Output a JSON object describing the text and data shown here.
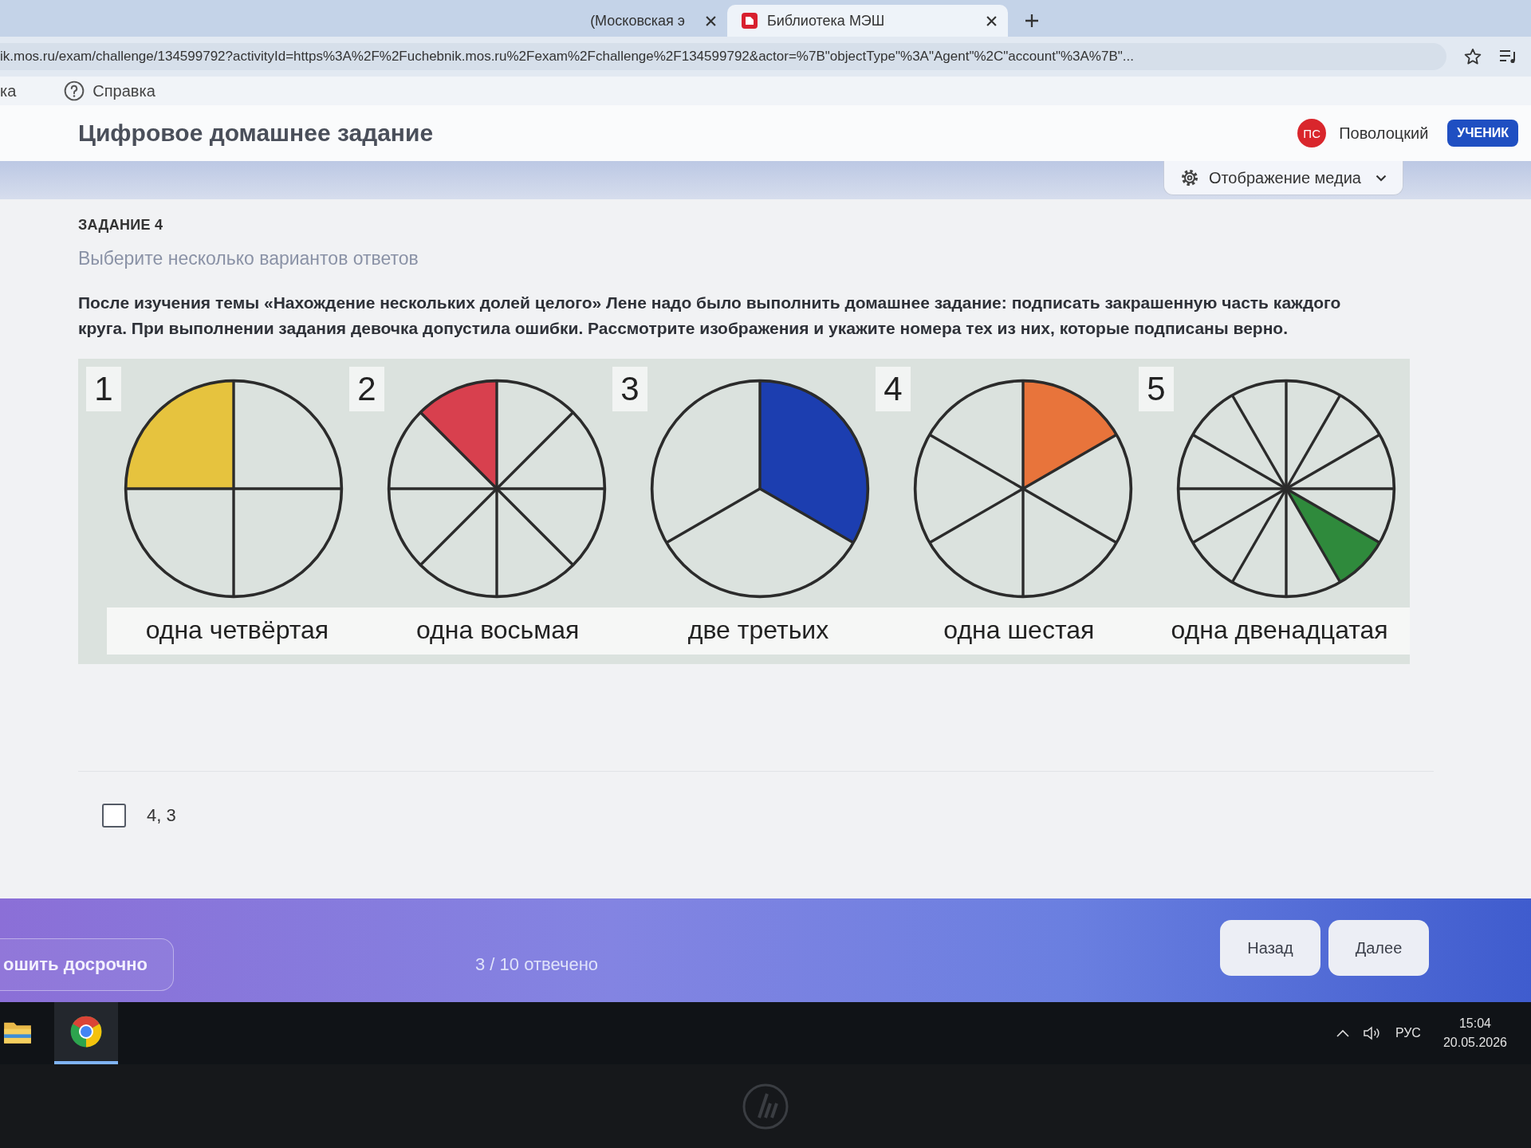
{
  "browser": {
    "tabs": [
      {
        "title": "(Московская э",
        "favicon": false,
        "selected": false
      },
      {
        "title": "Библиотека МЭШ",
        "favicon": true,
        "selected": true
      }
    ],
    "address": "ik.mos.ru/exam/challenge/134599792?activityId=https%3A%2F%2Fuchebnik.mos.ru%2Fexam%2Fchallenge%2F134599792&actor=%7B\"objectType\"%3A\"Agent\"%2C\"account\"%3A%7B\"...",
    "bookmarks": [
      {
        "label": "ка",
        "kind": "plain"
      },
      {
        "label": "Справка",
        "kind": "help"
      }
    ]
  },
  "header": {
    "title": "Цифровое домашнее задание",
    "user": {
      "initials": "ПС",
      "name": "Поволоцкий",
      "role": "УЧЕНИК"
    },
    "media_menu": "Отображение медиа"
  },
  "task": {
    "number": "ЗАДАНИЕ 4",
    "instruction": "Выберите несколько вариантов ответов",
    "text": "После изучения темы «Нахождение нескольких долей целого» Лене надо было выполнить домашнее задание: подписать закрашенную часть каждого круга. При выполнении задания девочка допустила ошибки. Рассмотрите изображения и укажите номера тех из них, которые подписаны верно.",
    "figure": {
      "items": [
        {
          "number": "1",
          "caption": "одна четвёртая",
          "kind": "quarters",
          "color": "#e6c33e"
        },
        {
          "number": "2",
          "caption": "одна восьмая",
          "kind": "eighths",
          "color": "#d8404e"
        },
        {
          "number": "3",
          "caption": "две третьих",
          "kind": "thirds",
          "color": "#1c3eb0"
        },
        {
          "number": "4",
          "caption": "одна шестая",
          "kind": "sixths",
          "color": "#e8743b"
        },
        {
          "number": "5",
          "caption": "одна двенадцатая",
          "kind": "twelfths",
          "color": "#2f8a3c"
        }
      ]
    },
    "options": [
      {
        "label": "4, 3",
        "checked": false
      }
    ]
  },
  "footer": {
    "finish": "ошить досрочно",
    "progress": "3 / 10 отвечено",
    "buttons": [
      "Назад",
      "Далее"
    ]
  },
  "taskbar": {
    "apps": [
      {
        "kind": "folder",
        "active": false
      },
      {
        "kind": "browser",
        "active": true
      }
    ],
    "tray": {
      "language": "РУС",
      "time": "15:04",
      "date": "20.05.2026"
    }
  }
}
